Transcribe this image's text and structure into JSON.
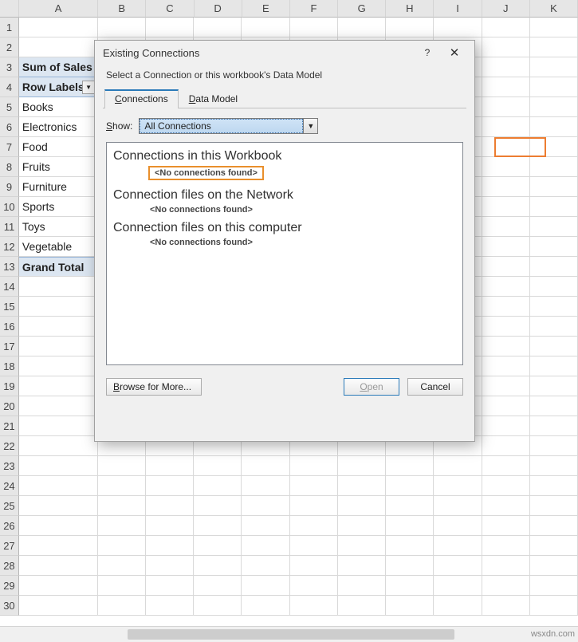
{
  "columns": [
    "A",
    "B",
    "C",
    "D",
    "E",
    "F",
    "G",
    "H",
    "I",
    "J",
    "K"
  ],
  "rows": [
    {
      "n": "1",
      "a": ""
    },
    {
      "n": "2",
      "a": ""
    },
    {
      "n": "3",
      "a": "Sum of Sales",
      "cls": "pivothead"
    },
    {
      "n": "4",
      "a": "Row Labels",
      "cls": "rowlabels",
      "arrow": true
    },
    {
      "n": "5",
      "a": "Books",
      "cls": "pivotitem"
    },
    {
      "n": "6",
      "a": "Electronics",
      "cls": "pivotitem"
    },
    {
      "n": "7",
      "a": "Food",
      "cls": "pivotitem"
    },
    {
      "n": "8",
      "a": "Fruits",
      "cls": "pivotitem"
    },
    {
      "n": "9",
      "a": "Furniture",
      "cls": "pivotitem"
    },
    {
      "n": "10",
      "a": "Sports",
      "cls": "pivotitem"
    },
    {
      "n": "11",
      "a": "Toys",
      "cls": "pivotitem"
    },
    {
      "n": "12",
      "a": "Vegetable",
      "cls": "pivotitem"
    },
    {
      "n": "13",
      "a": "Grand Total",
      "cls": "grandtotal"
    },
    {
      "n": "14",
      "a": ""
    },
    {
      "n": "15",
      "a": ""
    },
    {
      "n": "16",
      "a": ""
    },
    {
      "n": "17",
      "a": ""
    },
    {
      "n": "18",
      "a": ""
    },
    {
      "n": "19",
      "a": ""
    },
    {
      "n": "20",
      "a": ""
    },
    {
      "n": "21",
      "a": ""
    },
    {
      "n": "22",
      "a": ""
    },
    {
      "n": "23",
      "a": ""
    },
    {
      "n": "24",
      "a": ""
    },
    {
      "n": "25",
      "a": ""
    },
    {
      "n": "26",
      "a": ""
    },
    {
      "n": "27",
      "a": ""
    },
    {
      "n": "28",
      "a": ""
    },
    {
      "n": "29",
      "a": ""
    },
    {
      "n": "30",
      "a": ""
    }
  ],
  "dialog": {
    "title": "Existing Connections",
    "subtitle": "Select a Connection or this workbook's Data Model",
    "tabs": {
      "connections": "Connections",
      "datamodel": "Data Model"
    },
    "show_label": "Show:",
    "show_value": "All Connections",
    "groups": {
      "g1": "Connections in this Workbook",
      "g2": "Connection files on the Network",
      "g3": "Connection files on this computer",
      "none": "<No connections found>"
    },
    "buttons": {
      "browse": "Browse for More...",
      "open": "Open",
      "cancel": "Cancel"
    }
  },
  "watermark": "wsxdn.com"
}
